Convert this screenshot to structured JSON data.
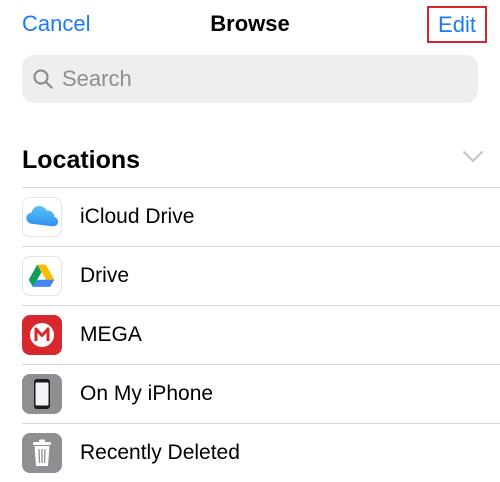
{
  "nav": {
    "cancel_label": "Cancel",
    "title": "Browse",
    "edit_label": "Edit"
  },
  "search": {
    "placeholder": "Search"
  },
  "locations": {
    "title": "Locations",
    "items": [
      {
        "label": "iCloud Drive",
        "icon": "icloud-icon"
      },
      {
        "label": "Drive",
        "icon": "google-drive-icon"
      },
      {
        "label": "MEGA",
        "icon": "mega-icon"
      },
      {
        "label": "On My iPhone",
        "icon": "iphone-icon"
      },
      {
        "label": "Recently Deleted",
        "icon": "trash-icon"
      }
    ]
  },
  "colors": {
    "accent": "#1a7cf0",
    "highlight_border": "#d9232e",
    "search_bg": "#eeeeef",
    "placeholder": "#8e8e93",
    "separator": "#d7d7da",
    "mega_red": "#d9272e",
    "iphone_gray": "#8e8e93"
  }
}
